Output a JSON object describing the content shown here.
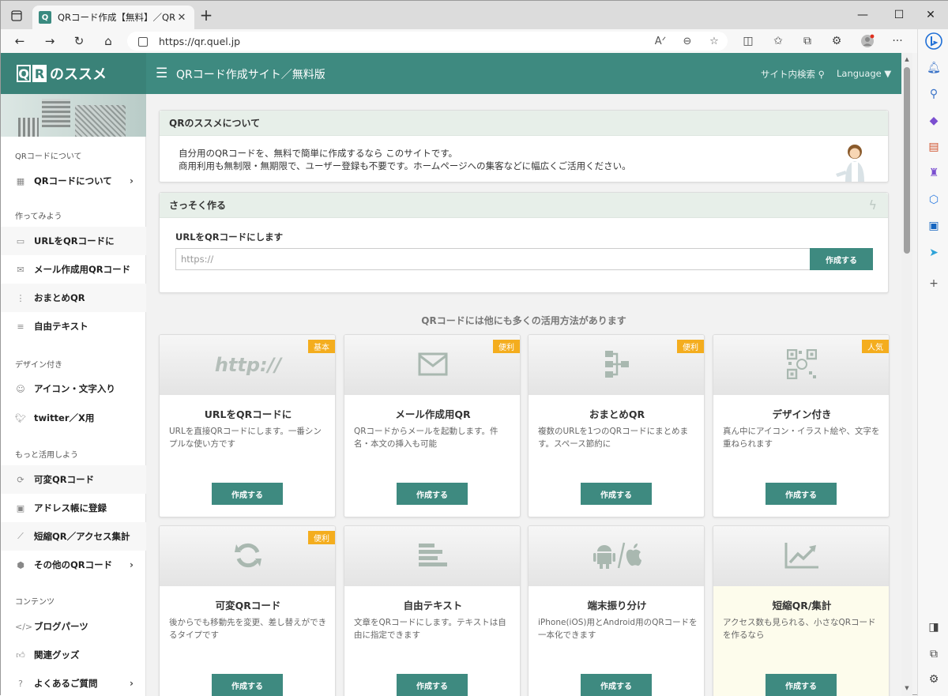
{
  "browser": {
    "tab_title": "QRコード作成【無料】／QRのススメ",
    "tab_favicon": "Q",
    "url": "https://qr.quel.jp"
  },
  "site": {
    "logo_q": "Q",
    "logo_r": "R",
    "logo_text": "のススメ",
    "title": "QRコード作成サイト／無料版",
    "search_label": "サイト内検索",
    "language_label": "Language ▼"
  },
  "sidebar": {
    "sections": [
      "QRコードについて",
      "作ってみよう",
      "デザイン付き",
      "もっと活用しよう",
      "コンテンツ"
    ],
    "items": [
      {
        "label": "QRコードについて",
        "chev": "›"
      },
      {
        "label": "URLをQRコードに"
      },
      {
        "label": "メール作成用QRコード"
      },
      {
        "label": "おまとめQR"
      },
      {
        "label": "自由テキスト"
      },
      {
        "label": "アイコン・文字入り"
      },
      {
        "label": "twitter／X用"
      },
      {
        "label": "可変QRコード"
      },
      {
        "label": "アドレス帳に登録"
      },
      {
        "label": "短縮QR／アクセス集計"
      },
      {
        "label": "その他のQRコード",
        "chev": "›"
      },
      {
        "label": "ブログパーツ"
      },
      {
        "label": "関連グッズ"
      },
      {
        "label": "よくあるご質問",
        "chev": "›"
      }
    ]
  },
  "about": {
    "header": "QRのススメについて",
    "line1": "自分用のQRコードを、無料で簡単に作成するなら このサイトです。",
    "line2": "商用利用も無制限・無期限で、ユーザー登録も不要です。ホームページへの集客などに幅広くご活用ください。"
  },
  "quick": {
    "header": "さっそく作る",
    "label": "URLをQRコードにします",
    "placeholder": "https://",
    "button": "作成する"
  },
  "more_title": "QRコードには他にも多くの活用方法があります",
  "tiles": [
    {
      "badge": "基本",
      "icon_text": "http://",
      "title": "URLをQRコードに",
      "desc": "URLを直接QRコードにします。一番シンプルな使い方です",
      "button": "作成する"
    },
    {
      "badge": "便利",
      "title": "メール作成用QR",
      "desc": "QRコードからメールを起動します。件名・本文の挿入も可能",
      "button": "作成する"
    },
    {
      "badge": "便利",
      "title": "おまとめQR",
      "desc": "複数のURLを1つのQRコードにまとめます。スペース節約に",
      "button": "作成する"
    },
    {
      "badge": "人気",
      "title": "デザイン付き",
      "desc": "真ん中にアイコン・イラスト絵や、文字を重ねられます",
      "button": "作成する"
    },
    {
      "badge": "便利",
      "title": "可変QRコード",
      "desc": "後からでも移動先を変更、差し替えができるタイプです",
      "button": "作成する"
    },
    {
      "title": "自由テキスト",
      "desc": "文章をQRコードにします。テキストは自由に指定できます",
      "button": "作成する"
    },
    {
      "title": "端末振り分け",
      "desc": "iPhone(iOS)用とAndroid用のQRコードを一本化できます",
      "button": "作成する"
    },
    {
      "title": "短縮QR/集計",
      "desc": "アクセス数も見られる、小さなQRコードを作るなら",
      "button": "作成する"
    }
  ],
  "colors": {
    "brand": "#3e8a80",
    "badge": "#f4ad1e",
    "card_header": "#e7efe9"
  }
}
